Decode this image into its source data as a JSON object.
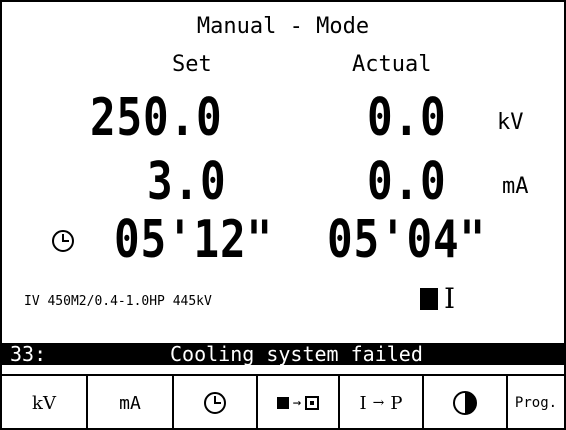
{
  "header": {
    "title": "Manual - Mode"
  },
  "columns": {
    "set_label": "Set",
    "actual_label": "Actual"
  },
  "voltage": {
    "set": "250.0",
    "actual": "0.0",
    "unit": "kV"
  },
  "current": {
    "set": "3.0",
    "actual": "0.0",
    "unit": "mA"
  },
  "timer": {
    "icon": "clock-icon",
    "set": "05'12\"",
    "actual": "05'04\""
  },
  "tube": {
    "model": "IV 450M2/0.4-1.0HP 445kV"
  },
  "xray_state": {
    "icon": "filled-square-icon",
    "label": "I"
  },
  "status": {
    "code": "33:",
    "message": "Cooling system failed"
  },
  "function_keys": [
    {
      "label": "kV"
    },
    {
      "label": "mA"
    },
    {
      "icon": "clock-icon"
    },
    {
      "icon": "filled-square-to-boxed-square-icon",
      "arrow": "→"
    },
    {
      "left": "I",
      "arrow": "→",
      "right": "P"
    },
    {
      "icon": "half-circle-contrast-icon"
    },
    {
      "label": "Prog."
    }
  ]
}
